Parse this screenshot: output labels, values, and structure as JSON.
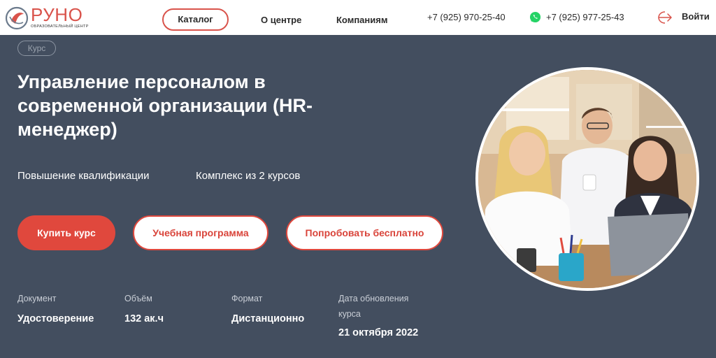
{
  "header": {
    "logo_text": "РУНО",
    "logo_sub": "ОБРАЗОВАТЕЛЬНЫЙ ЦЕНТР",
    "nav": {
      "catalog": "Каталог",
      "about": "О центре",
      "companies": "Компаниям"
    },
    "phone1": "+7 (925) 970-25-40",
    "phone2": "+7 (925) 977-25-43",
    "login": "Войти"
  },
  "hero": {
    "badge": "Курс",
    "title": "Управление персоналом в современной организации (HR-менеджер)",
    "meta1": "Повышение квалификации",
    "meta2": "Комплекс из 2 курсов",
    "buttons": {
      "buy": "Купить курс",
      "program": "Учебная программа",
      "try_free": "Попробовать бесплатно"
    },
    "info": [
      {
        "label": "Документ",
        "value": "Удостоверение"
      },
      {
        "label": "Объём",
        "value": "132 ак.ч"
      },
      {
        "label": "Формат",
        "value": "Дистанционно"
      },
      {
        "label": "Дата обновления курса",
        "value": "21 октября 2022"
      }
    ]
  },
  "colors": {
    "accent": "#e0483d",
    "hero_bg": "#434e5f",
    "header_bg": "#ffffff",
    "whatsapp": "#25d366"
  },
  "icons": [
    "logo-mark-icon",
    "whatsapp-icon",
    "login-arrow-icon"
  ]
}
